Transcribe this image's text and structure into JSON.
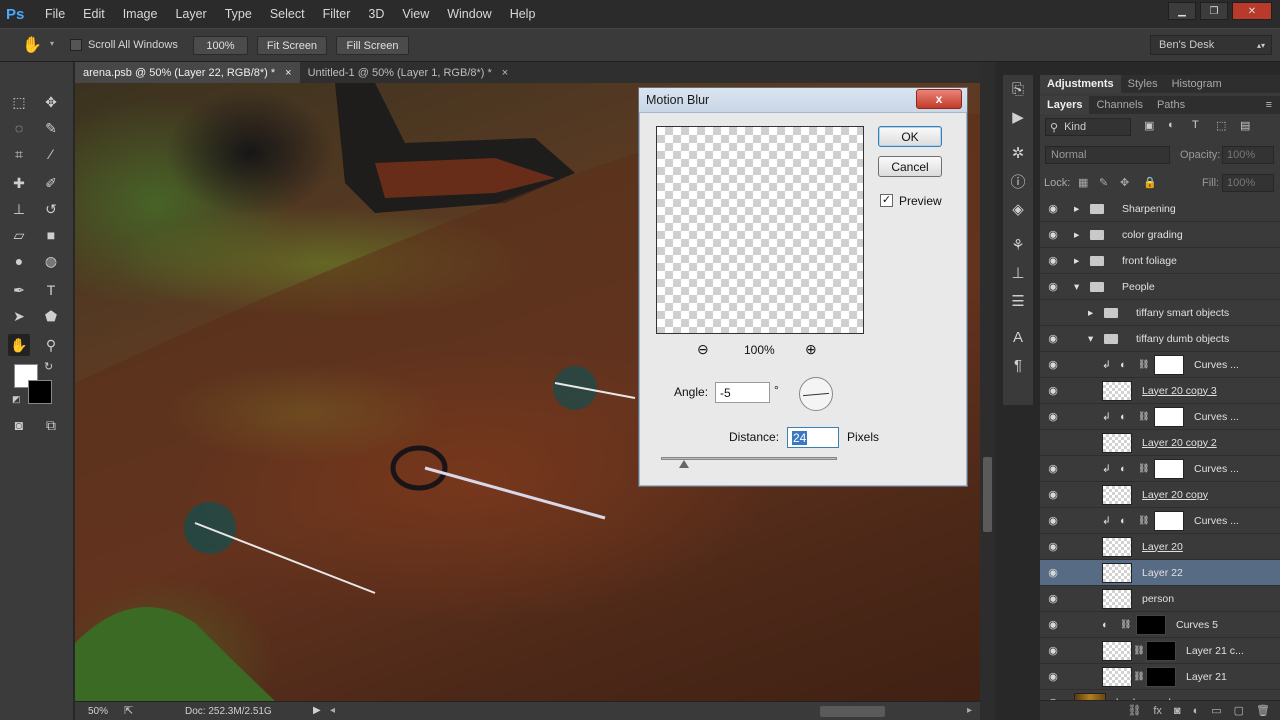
{
  "app": {
    "logo": "Ps"
  },
  "menu": [
    "File",
    "Edit",
    "Image",
    "Layer",
    "Type",
    "Select",
    "Filter",
    "3D",
    "View",
    "Window",
    "Help"
  ],
  "options": {
    "scroll_all_windows": "Scroll All Windows",
    "zoom_100": "100%",
    "fit_screen": "Fit Screen",
    "fill_screen": "Fill Screen",
    "workspace": "Ben's Desk"
  },
  "tabs": [
    {
      "label": "arena.psb @ 50% (Layer 22, RGB/8*) *",
      "close": "×"
    },
    {
      "label": "Untitled-1 @ 50% (Layer 1, RGB/8*) *",
      "close": "×"
    }
  ],
  "status": {
    "zoom": "50%",
    "doc": "Doc: 252.3M/2.51G"
  },
  "dialog": {
    "title": "Motion Blur",
    "close": "x",
    "ok": "OK",
    "cancel": "Cancel",
    "preview_label": "Preview",
    "preview_checked": true,
    "preview_zoom": "100%",
    "angle_label": "Angle:",
    "angle_value": "-5",
    "degree": "°",
    "distance_label": "Distance:",
    "distance_value": "24",
    "distance_unit": "Pixels"
  },
  "panels": {
    "top_tabs": [
      "Adjustments",
      "Styles",
      "Histogram"
    ],
    "layer_tabs": [
      "Layers",
      "Channels",
      "Paths"
    ],
    "kind": "Kind",
    "blend_mode": "Normal",
    "opacity_label": "Opacity:",
    "opacity_value": "100%",
    "lock_label": "Lock:",
    "fill_label": "Fill:",
    "fill_value": "100%"
  },
  "layers": [
    {
      "name": "Sharpening",
      "type": "group",
      "indent": 0
    },
    {
      "name": "color grading",
      "type": "group",
      "indent": 0
    },
    {
      "name": "front foliage",
      "type": "group",
      "indent": 0
    },
    {
      "name": "People",
      "type": "group-open",
      "indent": 0
    },
    {
      "name": "tiffany smart objects",
      "type": "group",
      "indent": 1,
      "hidden": true
    },
    {
      "name": "tiffany dumb objects",
      "type": "group-open",
      "indent": 1
    },
    {
      "name": "Curves ...",
      "type": "adjust",
      "indent": 2
    },
    {
      "name": "Layer 20 copy 3",
      "type": "pixel",
      "indent": 2
    },
    {
      "name": "Curves ...",
      "type": "adjust",
      "indent": 2
    },
    {
      "name": "Layer 20 copy 2",
      "type": "pixel",
      "indent": 2,
      "hidden": true
    },
    {
      "name": "Curves ...",
      "type": "adjust",
      "indent": 2
    },
    {
      "name": "Layer 20 copy",
      "type": "pixel",
      "indent": 2
    },
    {
      "name": "Curves ...",
      "type": "adjust",
      "indent": 2
    },
    {
      "name": "Layer 20",
      "type": "pixel",
      "indent": 2
    },
    {
      "name": "Layer 22",
      "type": "pixel",
      "indent": 2,
      "selected": true
    },
    {
      "name": "person",
      "type": "pixel",
      "indent": 2
    },
    {
      "name": "Curves 5",
      "type": "adjust-black",
      "indent": 2
    },
    {
      "name": "Layer 21 c...",
      "type": "pixel-mask",
      "indent": 2
    },
    {
      "name": "Layer 21",
      "type": "pixel-mask",
      "indent": 2
    },
    {
      "name": "background",
      "type": "image",
      "indent": 0
    }
  ]
}
